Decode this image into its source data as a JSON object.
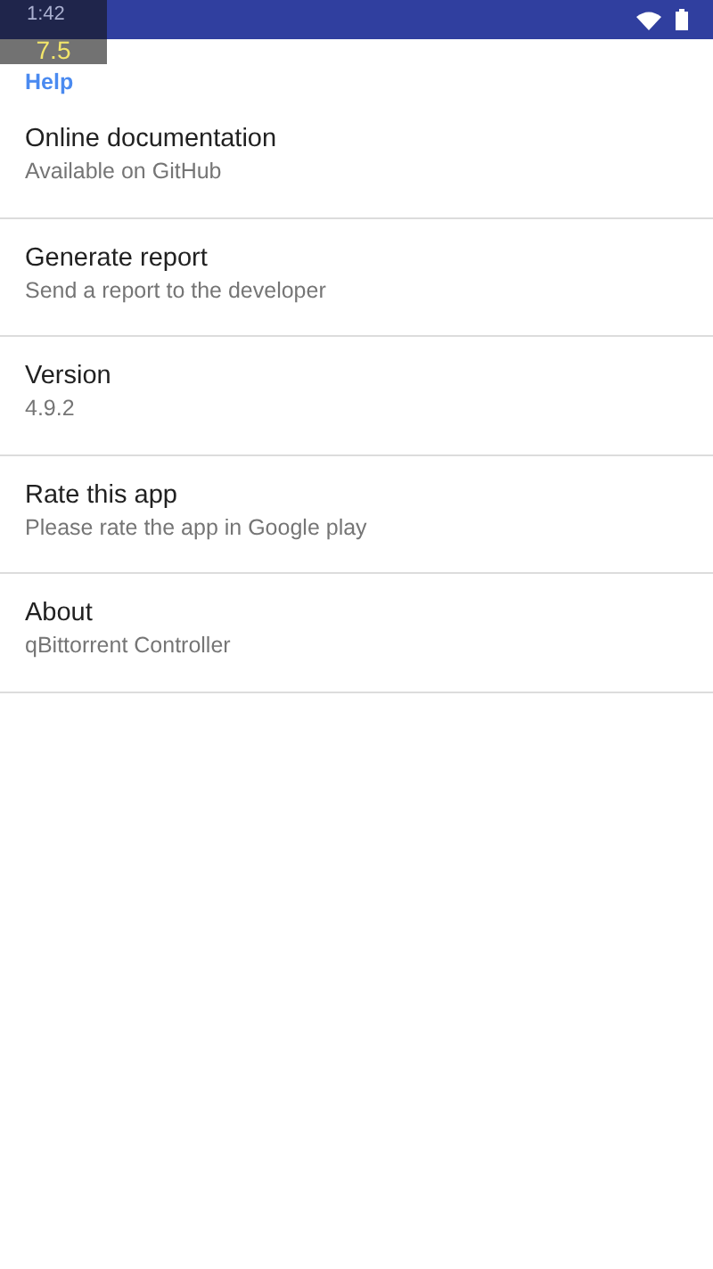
{
  "status_bar": {
    "time": "1:42"
  },
  "overlay": {
    "value": "7.5"
  },
  "section": {
    "title": "Help"
  },
  "items": [
    {
      "title": "Online documentation",
      "summary": "Available on GitHub"
    },
    {
      "title": "Generate report",
      "summary": "Send a report to the developer"
    },
    {
      "title": "Version",
      "summary": "4.9.2"
    },
    {
      "title": "Rate this app",
      "summary": "Please rate the app in Google play"
    },
    {
      "title": "About",
      "summary": "qBittorrent Controller"
    }
  ]
}
